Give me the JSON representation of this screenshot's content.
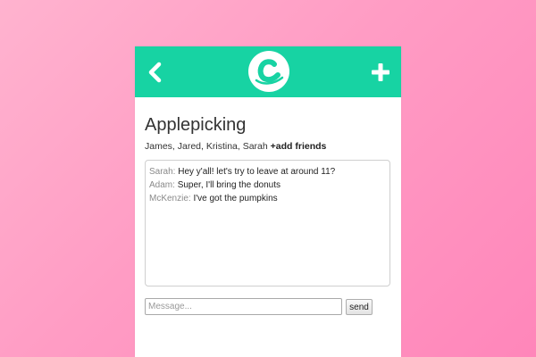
{
  "header": {
    "back_icon": "chevron-left-icon",
    "logo_icon": "c-logo-icon",
    "add_icon": "plus-icon",
    "accent_color": "#17d3a3"
  },
  "group": {
    "title": "Applepicking",
    "members": "James, Jared, Kristina, Sarah",
    "add_friends_label": "+add friends"
  },
  "messages": [
    {
      "sender": "Sarah:",
      "text": "Hey y'all! let's try to leave at around 11?"
    },
    {
      "sender": "Adam:",
      "text": "Super, I'll bring the donuts"
    },
    {
      "sender": "McKenzie:",
      "text": "I've got the pumpkins"
    }
  ],
  "composer": {
    "placeholder": "Message...",
    "value": "",
    "send_label": "send"
  },
  "colors": {
    "background": "#ff9cc4",
    "sender_name": "#8a8a8a"
  }
}
